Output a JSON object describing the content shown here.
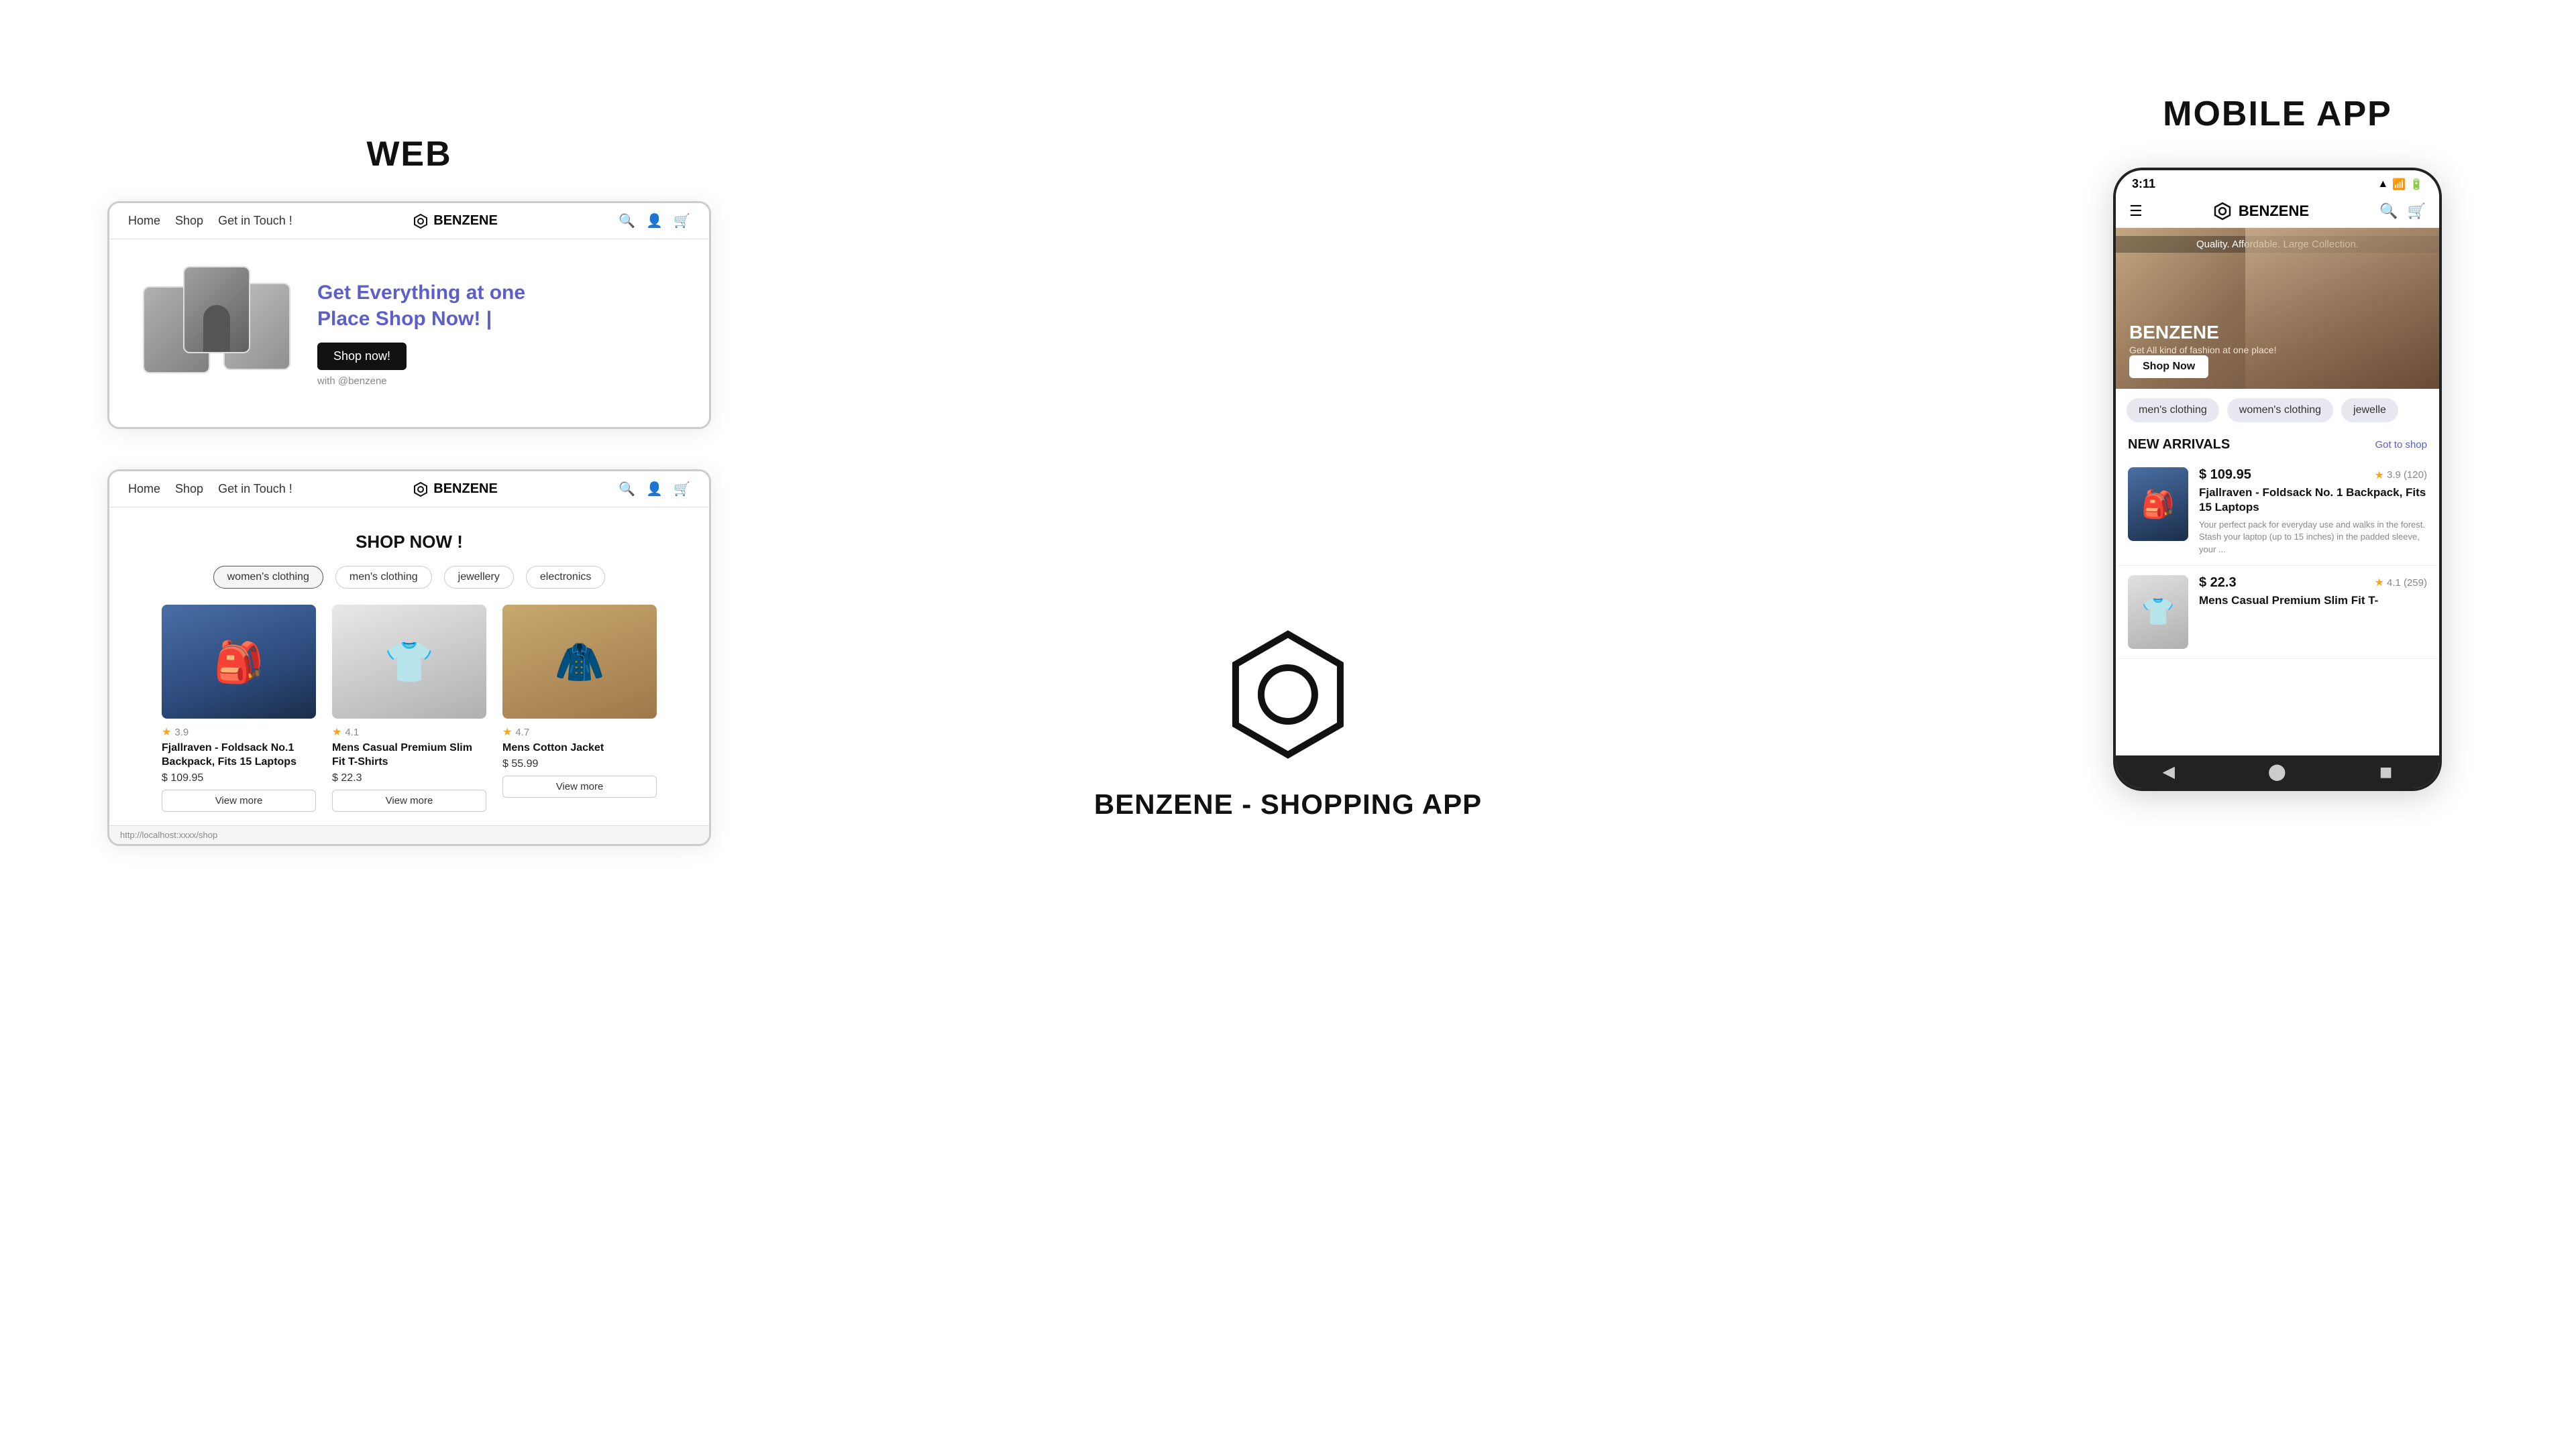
{
  "web": {
    "label": "WEB",
    "nav": {
      "links": [
        "Home",
        "Shop",
        "Get in Touch !"
      ],
      "brand": "BENZENE",
      "icons": [
        "🔍",
        "👤",
        "🛒"
      ]
    },
    "hero": {
      "heading1": "Get Everything at one",
      "heading2": "Place ",
      "heading_highlight": "Shop Now! |",
      "shop_btn": "Shop now!",
      "with_text": "with @benzene"
    },
    "shop": {
      "title": "SHOP NOW !",
      "categories": [
        "women's clothing",
        "men's clothing",
        "jewellery",
        "electronics"
      ],
      "products": [
        {
          "name": "Fjallraven - Foldsack No.1 Backpack, Fits 15 Laptops",
          "price": "$ 109.95",
          "rating": "3.9",
          "img_type": "backpack",
          "btn": "View more"
        },
        {
          "name": "Mens Casual Premium Slim Fit T-Shirts",
          "price": "$ 22.3",
          "rating": "4.1",
          "img_type": "tshirt",
          "btn": "View more"
        },
        {
          "name": "Mens Cotton Jacket",
          "price": "$ 55.99",
          "rating": "4.7",
          "img_type": "jacket",
          "btn": "View more"
        }
      ]
    },
    "status_bar": "http://localhost:xxxx/shop"
  },
  "center": {
    "app_name": "BENZENE - SHOPPING APP"
  },
  "mobile": {
    "label": "MOBILE APP",
    "status": {
      "time": "3:11",
      "icons": "▲ WiFi 📶 🔋"
    },
    "nav": {
      "brand": "BENZENE",
      "icons": [
        "🔍",
        "🛒"
      ]
    },
    "banner": {
      "subtitle": "Quality. Affordable. Large Collection.",
      "brand": "BENZENE",
      "tagline": "Get All kind of fashion at one place!",
      "shop_btn": "Shop Now"
    },
    "categories": [
      "men's clothing",
      "women's clothing",
      "jewelle"
    ],
    "new_arrivals": {
      "title": "NEW ARRIVALS",
      "link": "Got to shop"
    },
    "products": [
      {
        "price": "$ 109.95",
        "rating": "3.9 (120)",
        "name": "Fjallraven - Foldsack No. 1 Backpack, Fits 15 Laptops",
        "desc": "Your perfect pack for everyday use and walks in the forest. Stash your laptop (up to 15 inches) in the padded sleeve, your ...",
        "img_type": "backpack2"
      },
      {
        "price": "$ 22.3",
        "rating": "4.1 (259)",
        "name": "Mens Casual Premium Slim Fit T-",
        "desc": "",
        "img_type": "tshirt2"
      }
    ]
  },
  "icons": {
    "hexagon_stroke": "#111",
    "star": "⭐"
  }
}
